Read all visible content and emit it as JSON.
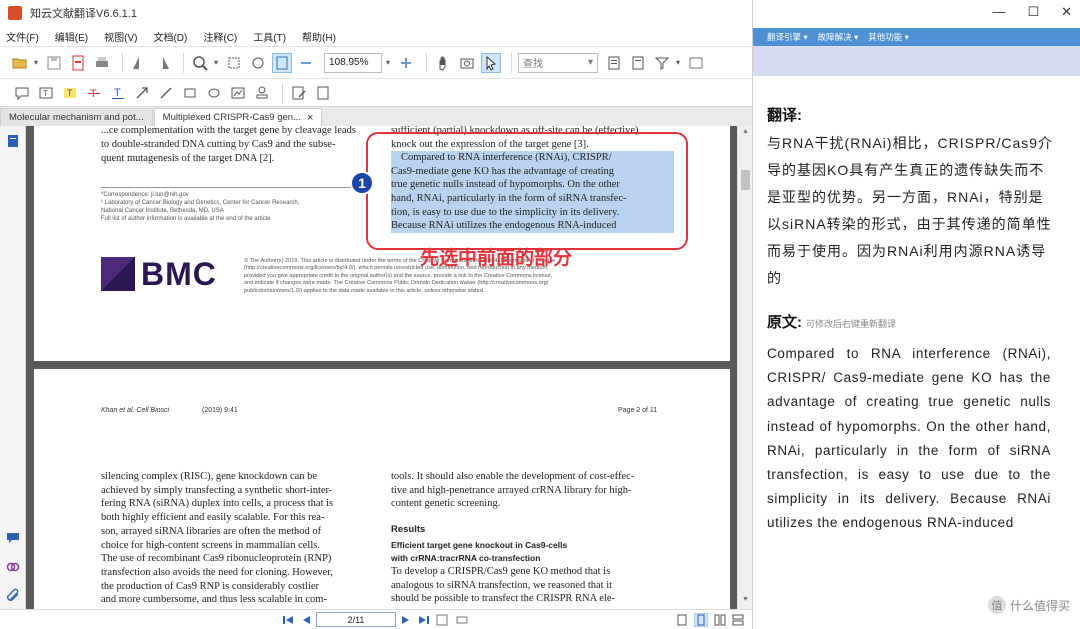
{
  "app": {
    "title": "知云文献翻译V6.6.1.1"
  },
  "menu": [
    "文件(F)",
    "编辑(E)",
    "视图(V)",
    "文档(D)",
    "注释(C)",
    "工具(T)",
    "帮助(H)"
  ],
  "toolbar": {
    "zoom_value": "108.95%",
    "find_placeholder": "查找"
  },
  "tabs": [
    {
      "label": "Molecular mechanism and pot..."
    },
    {
      "label": "Multiplexed CRISPR-Cas9 gen...",
      "close": "×"
    }
  ],
  "page1": {
    "col_left": [
      "...ce complementation with the target gene by cleavage leads",
      "to double-stranded DNA cutting by Cas9 and the subse-",
      "quent mutagenesis of the target DNA [2]."
    ],
    "col_right_top": [
      "sufficient (partial) knockdown as off-site can be (effective)",
      "knock out the expression of the target gene [3]."
    ],
    "col_right_sel": [
      "Compared to RNA interference (RNAi), CRISPR/",
      "Cas9-mediate gene KO has the advantage of creating",
      "true genetic nulls instead of hypomorphs. On the other",
      "hand, RNAi, particularly in the form of siRNA transfec-",
      "tion, is easy to use due to the simplicity in its delivery.",
      "Because RNAi utilizes the endogenous RNA-induced"
    ],
    "footnotes": [
      "*Correspondence: ji.luo@nih.gov",
      "¹ Laboratory of Cancer Biology and Genetics, Center for Cancer Research,",
      "National Cancer Institute, Bethesda, MD, USA",
      "Full list of author information is available at the end of the article"
    ],
    "logo": "BMC",
    "license": [
      "© The Author(s) 2019. This article is distributed under the terms of the Creative Commons Attribution 4.0 International License",
      "(http://creativecommons.org/licenses/by/4.0/), which permits unrestricted use, distribution, and reproduction in any medium,",
      "provided you give appropriate credit to the original author(s) and the source, provide a link to the Creative Commons license,",
      "and indicate if changes were made. The Creative Commons Public Domain Dedication waiver (http://creativecommons.org/",
      "publicdomain/zero/1.0/) applies to the data made available in this article, unless otherwise stated."
    ]
  },
  "page2": {
    "header_left": "Khan et al. Cell Biosci",
    "header_mid": "(2019) 9:41",
    "header_right": "Page 2 of 11",
    "col_left": [
      "silencing complex (RISC), gene knockdown can be",
      "achieved by simply transfecting a synthetic short-inter-",
      "fering RNA (siRNA) duplex into cells, a process that is",
      "both highly efficient and easily scalable. For this rea-",
      "son, arrayed siRNA libraries are often the method of",
      "choice for high-content screens in mammalian cells.",
      "The use of recombinant Cas9 ribonucleoprotein (RNP)",
      "transfection also avoids the need for cloning. However,",
      "the production of Cas9 RNP is considerably costlier",
      "and more cumbersome, and thus less scalable in com-"
    ],
    "col_right_top": [
      "tools. It should also enable the development of cost-effec-",
      "tive and high-penetrance arrayed crRNA library for high-",
      "content genetic screening."
    ],
    "section_heading": "Results",
    "subsection_heading": [
      "Efficient target gene knockout in Cas9-cells",
      "with crRNA:tracrRNA co-transfection"
    ],
    "col_right_body": [
      "To develop a CRISPR/Cas9 gene KO method that is",
      "analogous to siRNA transfection, we reasoned that it",
      "should be possible to transfect the CRISPR RNA ele-"
    ]
  },
  "status": {
    "page_indicator": "2/11"
  },
  "annotation": {
    "number": "1",
    "label": "先选中前面的部分"
  },
  "translate_pane": {
    "menus": [
      "翻译引擎 ▾",
      "故障解决 ▾",
      "其他功能 ▾"
    ],
    "translation_heading": "翻译:",
    "translation_text": "与RNA干扰(RNAi)相比，CRISPR/Cas9介导的基因KO具有产生真正的遗传缺失而不是亚型的优势。另一方面，RNAi，特别是以siRNA转染的形式，由于其传递的简单性而易于使用。因为RNAi利用内源RNA诱导的",
    "original_heading": "原文:",
    "original_hint": "可修改后右键重新翻译",
    "original_text": "Compared to RNA interference (RNAi), CRISPR/ Cas9-mediate gene KO has the advantage of creating true genetic nulls instead of hypomorphs. On the other hand, RNAi, particularly in the form of siRNA transfection, is easy to use due to the simplicity in its delivery. Because RNAi utilizes the endogenous RNA-induced"
  },
  "watermark": {
    "icon": "值",
    "text": "什么值得买"
  },
  "colors": {
    "accent_blue": "#4f8fd4",
    "selection": "#b9d3ee",
    "annotation_red": "#e2323a",
    "badge_blue": "#1d45a8",
    "bmc_purple": "#4b2a7b"
  }
}
